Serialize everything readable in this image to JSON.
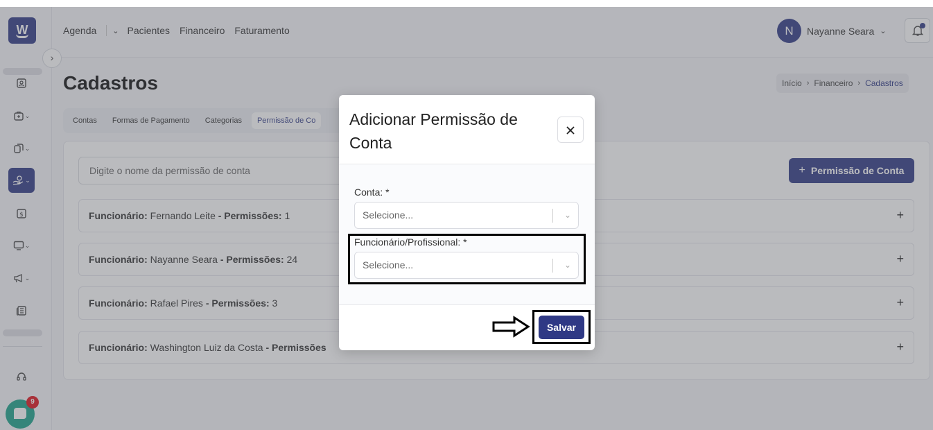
{
  "topnav": {
    "agenda": "Agenda",
    "pacientes": "Pacientes",
    "financeiro": "Financeiro",
    "faturamento": "Faturamento"
  },
  "user": {
    "initial": "N",
    "name": "Nayanne Seara"
  },
  "chat": {
    "badge": "9"
  },
  "page": {
    "title": "Cadastros",
    "breadcrumb": [
      "Início",
      "Financeiro",
      "Cadastros"
    ]
  },
  "tabs": [
    "Contas",
    "Formas de Pagamento",
    "Categorias",
    "Permissão de Co"
  ],
  "search": {
    "placeholder": "Digite o nome da permissão de conta"
  },
  "add_button": {
    "label": "Permissão de Conta"
  },
  "rows": [
    {
      "label_funcionario": "Funcionário:",
      "name": "Fernando Leite",
      "label_permissoes": "- Permissões:",
      "count": "1"
    },
    {
      "label_funcionario": "Funcionário:",
      "name": "Nayanne Seara",
      "label_permissoes": "- Permissões:",
      "count": "24"
    },
    {
      "label_funcionario": "Funcionário:",
      "name": "Rafael Pires",
      "label_permissoes": "- Permissões:",
      "count": "3"
    },
    {
      "label_funcionario": "Funcionário:",
      "name": "Washington Luiz da Costa",
      "label_permissoes": "- Permissões",
      "count": ""
    }
  ],
  "modal": {
    "title": "Adicionar Permissão de Conta",
    "close": "×",
    "fields": [
      {
        "label": "Conta: *",
        "placeholder": "Selecione..."
      },
      {
        "label": "Funcionário/Profissional: *",
        "placeholder": "Selecione..."
      }
    ],
    "save": "Salvar"
  },
  "colors": {
    "primary": "#2f3985",
    "accent": "#1aa38a",
    "badge": "#e0121a"
  },
  "icons": [
    "calendar-user-icon",
    "medical-kit-icon",
    "documents-icon",
    "hand-money-icon",
    "dollar-icon",
    "monitor-icon",
    "megaphone-icon",
    "newspaper-icon",
    "headset-icon",
    "bell-icon",
    "chat-icon",
    "close-icon",
    "plus-icon",
    "chevron-down-icon",
    "arrow-right-icon"
  ]
}
